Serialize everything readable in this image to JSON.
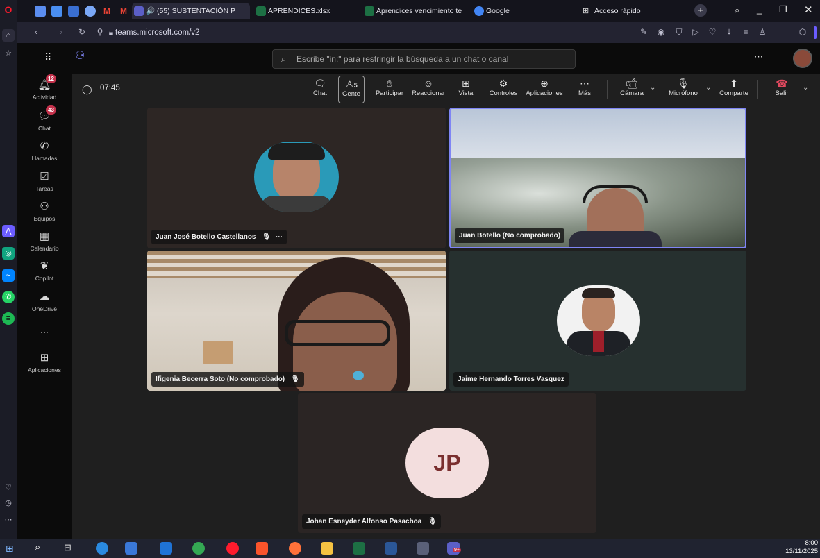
{
  "browser": {
    "tabs": [
      {
        "label": "🔊 (55) SUSTENTACIÓN P",
        "favicon_color": "#5b5fc7"
      },
      {
        "label": "APRENDICES.xlsx",
        "favicon_color": "#1d7044"
      },
      {
        "label": "Aprendices vencimiento te",
        "favicon_color": "#1d7044"
      },
      {
        "label": "Google",
        "favicon_color": "#4285f4"
      }
    ],
    "quick_access": "Acceso rápido",
    "url": "teams.microsoft.com/v2"
  },
  "teams": {
    "search_placeholder": "Escribe \"in:\" para restringir la búsqueda a un chat o canal",
    "rail": [
      {
        "label": "Actividad",
        "badge": "12",
        "icon": "bell-icon"
      },
      {
        "label": "Chat",
        "badge": "43",
        "icon": "chat-icon"
      },
      {
        "label": "Llamadas",
        "badge": "",
        "icon": "phone-icon"
      },
      {
        "label": "Tareas",
        "badge": "",
        "icon": "tasks-icon"
      },
      {
        "label": "Equipos",
        "badge": "",
        "icon": "teams-icon"
      },
      {
        "label": "Calendario",
        "badge": "",
        "icon": "calendar-icon"
      },
      {
        "label": "Copilot",
        "badge": "",
        "icon": "copilot-icon"
      },
      {
        "label": "OneDrive",
        "badge": "",
        "icon": "cloud-icon"
      },
      {
        "label": "Aplicaciones",
        "badge": "",
        "icon": "apps-icon"
      }
    ],
    "more_label": "...",
    "meeting": {
      "timer": "07:45",
      "toolbar": {
        "chat": "Chat",
        "people": "Gente",
        "people_count": "5",
        "raise": "Participar",
        "react": "Reaccionar",
        "view": "Vista",
        "controls": "Controles",
        "apps": "Aplicaciones",
        "more": "Más",
        "camera": "Cámara",
        "mic": "Micrófono",
        "share": "Comparte",
        "leave": "Salir"
      },
      "participants": [
        {
          "name": "Juan José Botello Castellanos",
          "muted": true
        },
        {
          "name": "Juan Botello (No comprobado)",
          "muted": false
        },
        {
          "name": "Ifigenia Becerra Soto (No comprobado)",
          "muted": true
        },
        {
          "name": "Jaime Hernando Torres Vasquez",
          "muted": false
        },
        {
          "name": "Johan Esneyder Alfonso Pasachoa",
          "muted": true,
          "initials": "JP"
        }
      ]
    }
  },
  "taskbar": {
    "time": "8:00",
    "date": "13/11/2025",
    "teams_badge": "9+"
  },
  "colors": {
    "accent": "#7f85f5",
    "leave": "#c4314b",
    "badge": "#c4314b"
  }
}
